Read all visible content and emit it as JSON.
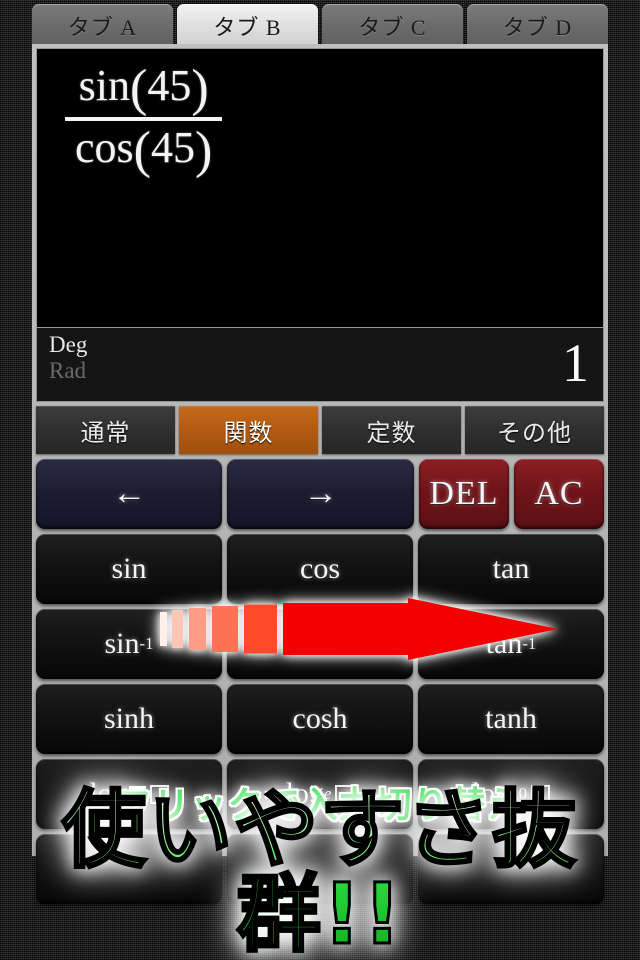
{
  "tabs": [
    {
      "label": "タブ A",
      "active": false
    },
    {
      "label": "タブ B",
      "active": true
    },
    {
      "label": "タブ C",
      "active": false
    },
    {
      "label": "タブ D",
      "active": false
    }
  ],
  "display": {
    "numerator_fn": "sin",
    "numerator_arg": "45",
    "denominator_fn": "cos",
    "denominator_arg": "45",
    "paren_open": "(",
    "paren_close": ")",
    "expression_text": "sin(45) / cos(45)"
  },
  "status": {
    "deg_label": "Deg",
    "rad_label": "Rad",
    "active_angle_mode": "Deg",
    "result": "1"
  },
  "categories": [
    {
      "label": "通常",
      "active": false
    },
    {
      "label": "関数",
      "active": true
    },
    {
      "label": "定数",
      "active": false
    },
    {
      "label": "その他",
      "active": false
    }
  ],
  "nav_row": {
    "left_label": "←",
    "right_label": "→",
    "del_label": "DEL",
    "ac_label": "AC"
  },
  "keys": {
    "row1": [
      "sin",
      "cos",
      "tan"
    ],
    "row2_base": [
      "sin",
      "cos",
      "tan"
    ],
    "row2_sup": "-1",
    "row3": [
      "sinh",
      "cosh",
      "tanh"
    ],
    "row4": [
      {
        "base": "log",
        "sub": "■",
        "sub_style": "filled-box",
        "placeholder": "□"
      },
      {
        "base": "log",
        "sub": "e",
        "sub_style": "italic",
        "placeholder": "□"
      },
      {
        "base": "log",
        "sub": "10",
        "sub_style": "digits",
        "placeholder": "□"
      }
    ],
    "row5": [
      "",
      "",
      ""
    ]
  },
  "overlays": {
    "flick_caption": "フリックで入力切り替え",
    "bottom_banner": "使いやすさ抜群!!",
    "arrow_name": "red-right-arrow",
    "arrow_tail_colors": [
      "#fff0ec",
      "#ffc5b5",
      "#ff9c85",
      "#ff7355",
      "#ff4a2a",
      "#ff0f00"
    ],
    "arrow_body_color": "#f40000"
  },
  "colors": {
    "accent_orange": "#b25a12",
    "caption_green": "#2fdc4a",
    "key_dark": "#121212",
    "nav_navy": "#1d1d32",
    "del_red": "#701419",
    "panel_gray": "#b3b3b3",
    "display_black": "#000000"
  }
}
